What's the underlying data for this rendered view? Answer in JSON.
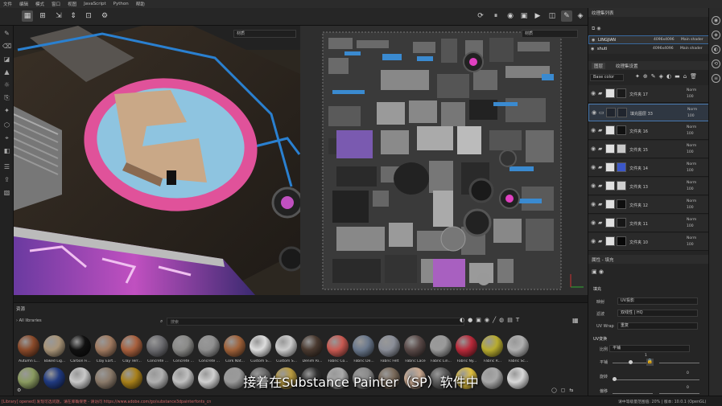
{
  "menu": [
    "文件",
    "编辑",
    "模式",
    "窗口",
    "视图",
    "JavaScript",
    "Python",
    "帮助"
  ],
  "viewport3d": {
    "channel_select": "材质"
  },
  "viewport2d": {
    "channel_select": "材质"
  },
  "texture_set_panel": {
    "title": "纹理集列表",
    "sets": [
      {
        "name": "LINGJIAN",
        "size": "4096x4096",
        "shader": "Main shader"
      },
      {
        "name": "shuti",
        "size": "4096x4096",
        "shader": "Main shader"
      }
    ]
  },
  "layers_panel": {
    "tabs": [
      "图层",
      "纹理集设置"
    ],
    "channel_select": "Base color",
    "layers": [
      {
        "name": "文件夹 17",
        "blend": "Norm",
        "opacity": "100",
        "color": "#1a1a1a"
      },
      {
        "name": "填充图层 33",
        "blend": "Norm",
        "opacity": "100",
        "color": "#20252e",
        "selected": true
      },
      {
        "name": "文件夹 16",
        "blend": "Norm",
        "opacity": "100",
        "color": "#111111"
      },
      {
        "name": "文件夹 15",
        "blend": "Norm",
        "opacity": "100",
        "color": "#c8c8c8"
      },
      {
        "name": "文件夹 14",
        "blend": "Norm",
        "opacity": "100",
        "color": "#3b57c9"
      },
      {
        "name": "文件夹 13",
        "blend": "Norm",
        "opacity": "100",
        "color": "#d0d0d0"
      },
      {
        "name": "文件夹 12",
        "blend": "Norm",
        "opacity": "100",
        "color": "#0e0e0e"
      },
      {
        "name": "文件夹 11",
        "blend": "Norm",
        "opacity": "100",
        "color": "#161616"
      },
      {
        "name": "文件夹 10",
        "blend": "Norm",
        "opacity": "100",
        "color": "#080808"
      }
    ]
  },
  "properties_panel": {
    "title": "属性 - 填充",
    "section": "填充",
    "rows": [
      {
        "label": "映射",
        "value": "UV投影"
      },
      {
        "label": "滤波",
        "value": "双线性 | HQ"
      },
      {
        "label": "UV Wrap",
        "value": "重复"
      }
    ],
    "uv_section": "UV变换",
    "uv_rows": [
      {
        "label": "比例",
        "value": "平铺"
      },
      {
        "label": "平铺",
        "value": "1"
      },
      {
        "label": "旋转",
        "value": "0"
      },
      {
        "label": "偏移",
        "value": "0"
      }
    ]
  },
  "assets_panel": {
    "title": "资源",
    "library": "All libraries",
    "search_placeholder": "搜索",
    "row1": [
      {
        "label": "Autumn L...",
        "color": "#8a4a2a"
      },
      {
        "label": "Baked Lig...",
        "color": "#a89478"
      },
      {
        "label": "Carbon Fi...",
        "color": "#111111"
      },
      {
        "label": "Clay Eart...",
        "color": "#a07a60"
      },
      {
        "label": "Clay Terr...",
        "color": "#a8603e"
      },
      {
        "label": "Concrete ...",
        "color": "#6c6c70"
      },
      {
        "label": "Concrete ...",
        "color": "#8a8a88"
      },
      {
        "label": "Concrete ...",
        "color": "#909090"
      },
      {
        "label": "Cork Nat...",
        "color": "#a0623a"
      },
      {
        "label": "Custom S...",
        "color": "#dddddd"
      },
      {
        "label": "Custom S...",
        "color": "#cccccc"
      },
      {
        "label": "Denim Ri...",
        "color": "#4a3a30"
      },
      {
        "label": "Fabric Co...",
        "color": "#c85a52"
      },
      {
        "label": "Fabric De...",
        "color": "#6a788c"
      },
      {
        "label": "Fabric Felt",
        "color": "#8a8e98"
      },
      {
        "label": "Fabric Lace",
        "color": "#5a4a48"
      },
      {
        "label": "Fabric Lin...",
        "color": "#9a9a9a"
      },
      {
        "label": "Fabric Ny...",
        "color": "#b82a3a"
      },
      {
        "label": "Fabric R...",
        "color": "#b8ac30"
      },
      {
        "label": "Fabric Sc...",
        "color": "#b0b0b0"
      }
    ],
    "row2_colors": [
      "#8a9a60",
      "#203a80",
      "#c8c8c8",
      "#8a7a6a",
      "#a8801a",
      "#b0b0b0",
      "#c0c0c0",
      "#d0d0d0",
      "#9a9a9a",
      "#6a6a6a",
      "#b89a40",
      "#303030",
      "#aaaaaa",
      "#8a8a8a",
      "#7a6a5a",
      "#c8a890",
      "#5a5a5a",
      "#e0c040",
      "#a8a8a8",
      "#d8d8d8"
    ]
  },
  "subtitle": "接着在Substance Painter（SP）软件中",
  "status": {
    "log": "[Library] opened] 发现可选问题，请在库确保更 - 请访问 https://www.adobe.com/go/substance3dpainterfonts_cn",
    "right": "请中等级量范围值: 20% | 版本: 10.0.1 (OpenGL)"
  }
}
